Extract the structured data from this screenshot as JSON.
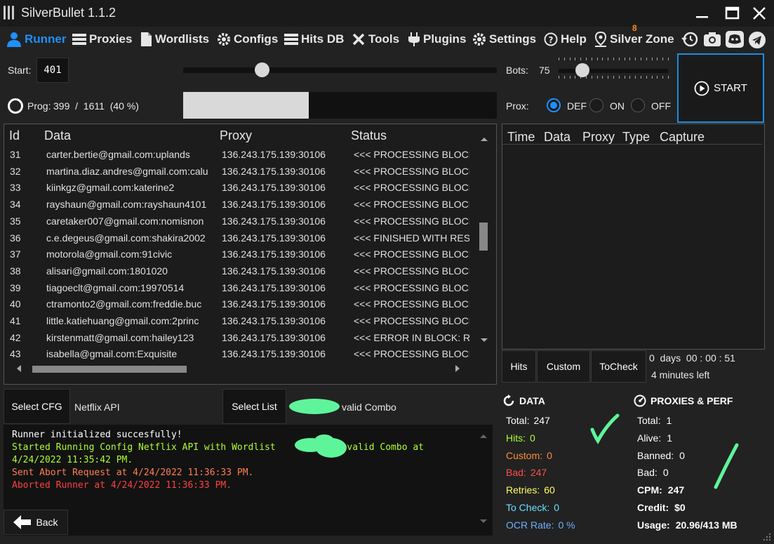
{
  "app": {
    "title": "SilverBullet 1.1.2"
  },
  "nav": {
    "items": [
      {
        "label": "Runner"
      },
      {
        "label": "Proxies"
      },
      {
        "label": "Wordlists"
      },
      {
        "label": "Configs"
      },
      {
        "label": "Hits DB"
      },
      {
        "label": "Tools"
      },
      {
        "label": "Plugins"
      },
      {
        "label": "Settings"
      },
      {
        "label": "Help"
      },
      {
        "label": "Silver Zone"
      }
    ],
    "badge": "8"
  },
  "controls": {
    "start_label": "Start:",
    "start_value": "401",
    "start_slider_fraction": 0.25,
    "bots_label": "Bots:",
    "bots_value": "75",
    "bots_slider_fraction": 0.22,
    "start_button": "START",
    "prog_label": "Prog:",
    "prog_text": "399  /  1611  (40 %)",
    "prog_fraction": 0.4,
    "prox_label": "Prox:",
    "prox_options": [
      "DEF",
      "ON",
      "OFF"
    ],
    "prox_selected": "DEF"
  },
  "grid": {
    "headers": [
      "Id",
      "Data",
      "Proxy",
      "Status"
    ],
    "rows": [
      {
        "id": "31",
        "data": "carter.bertie@gmail.com:uplands",
        "proxy": "136.243.175.139:30106",
        "status": "<<< PROCESSING BLOCK"
      },
      {
        "id": "32",
        "data": "martina.diaz.andres@gmail.com:calu",
        "proxy": "136.243.175.139:30106",
        "status": "<<< PROCESSING BLOCK"
      },
      {
        "id": "33",
        "data": "kiinkgz@gmail.com:katerine2",
        "proxy": "136.243.175.139:30106",
        "status": "<<< PROCESSING BLOCK"
      },
      {
        "id": "34",
        "data": "rayshaun@gmail.com:rayshaun4101",
        "proxy": "136.243.175.139:30106",
        "status": "<<< PROCESSING BLOCK"
      },
      {
        "id": "35",
        "data": "caretaker007@gmail.com:nomisnon",
        "proxy": "136.243.175.139:30106",
        "status": "<<< PROCESSING BLOCK"
      },
      {
        "id": "36",
        "data": "c.e.degeus@gmail.com:shakira2002",
        "proxy": "136.243.175.139:30106",
        "status": "<<< FINISHED WITH RES"
      },
      {
        "id": "37",
        "data": "motorola@gmail.com:91civic",
        "proxy": "136.243.175.139:30106",
        "status": "<<< PROCESSING BLOCK"
      },
      {
        "id": "38",
        "data": "alisari@gmail.com:1801020",
        "proxy": "136.243.175.139:30106",
        "status": "<<< PROCESSING BLOCK"
      },
      {
        "id": "39",
        "data": "tiagoeclt@gmail.com:19970514",
        "proxy": "136.243.175.139:30106",
        "status": "<<< PROCESSING BLOCK"
      },
      {
        "id": "40",
        "data": "ctramonto2@gmail.com:freddie.buc",
        "proxy": "136.243.175.139:30106",
        "status": "<<< PROCESSING BLOCK"
      },
      {
        "id": "41",
        "data": "little.katiehuang@gmail.com:2princ",
        "proxy": "136.243.175.139:30106",
        "status": "<<< PROCESSING BLOCK"
      },
      {
        "id": "42",
        "data": "kirstenmatt@gmail.com:hailey123",
        "proxy": "136.243.175.139:30106",
        "status": "<<< ERROR IN BLOCK: R"
      },
      {
        "id": "43",
        "data": "isabella@gmail.com:Exquisite",
        "proxy": "136.243.175.139:30106",
        "status": "<<< PROCESSING BLOCK"
      }
    ]
  },
  "hits": {
    "headers": [
      "Time",
      "Data",
      "Proxy",
      "Type",
      "Capture"
    ],
    "tabs": [
      "Hits",
      "Custom",
      "ToCheck"
    ],
    "elapsed": "0  days  00 : 00 : 51",
    "remaining": "4 minutes left"
  },
  "bottom": {
    "select_cfg": "Select CFG",
    "cfg_name": "Netflix API",
    "select_list": "Select List",
    "list_name": "valid Combo",
    "back": "Back"
  },
  "log": [
    {
      "text": "Runner initialized succesfully!",
      "color": "#ffffff"
    },
    {
      "text": "Started Running Config Netflix API with Wordlist             valid Combo at",
      "color": "#adff2f"
    },
    {
      "text": "4/24/2022 11:35:42 PM.",
      "color": "#adff2f"
    },
    {
      "text": "Sent Abort Request at 4/24/2022 11:36:33 PM.",
      "color": "#ff7f50"
    },
    {
      "text": "Aborted Runner at 4/24/2022 11:36:33 PM.",
      "color": "#ff4040"
    }
  ],
  "data_stats": {
    "title": "DATA",
    "items": [
      {
        "label": "Total:",
        "value": "247",
        "color": "#ffffff"
      },
      {
        "label": "Hits:",
        "value": "0",
        "color": "#adff2f"
      },
      {
        "label": "Custom:",
        "value": "0",
        "color": "#ff8c3a"
      },
      {
        "label": "Bad:",
        "value": "247",
        "color": "#ff4d4d"
      },
      {
        "label": "Retries:",
        "value": "60",
        "color": "#ffff66"
      },
      {
        "label": "To Check:",
        "value": "0",
        "color": "#66e0ff"
      },
      {
        "label": "OCR Rate:",
        "value": "0 %",
        "color": "#6ab0ff"
      }
    ]
  },
  "proxy_stats": {
    "title": "PROXIES & PERF",
    "items": [
      {
        "label": "Total:",
        "value": "1"
      },
      {
        "label": "Alive:",
        "value": "1"
      },
      {
        "label": "Banned:",
        "value": "0"
      },
      {
        "label": "Bad:",
        "value": "0"
      }
    ],
    "perf": [
      {
        "label": "CPM:",
        "value": "247"
      },
      {
        "label": "Credit:",
        "value": "$0"
      },
      {
        "label": "Usage:",
        "value": "20.96/413 MB"
      }
    ]
  }
}
